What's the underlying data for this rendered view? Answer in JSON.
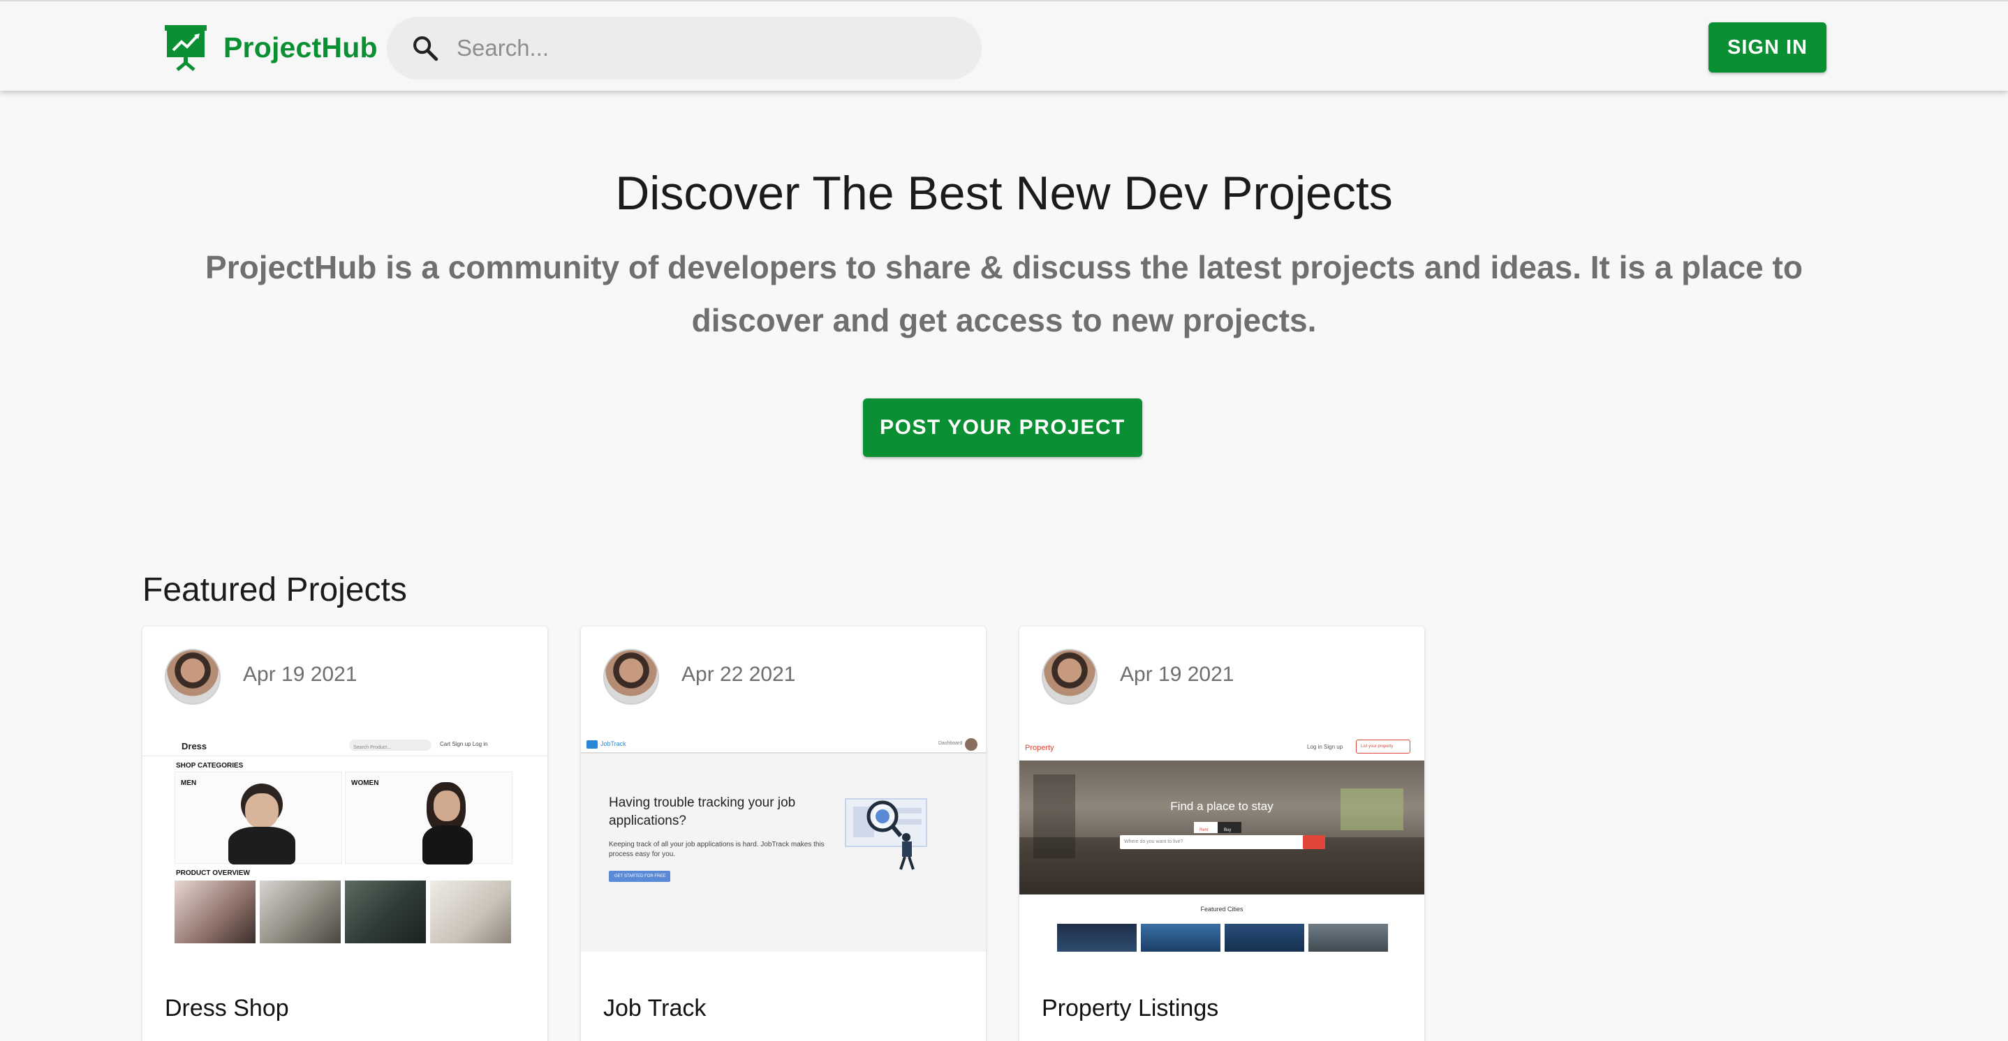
{
  "header": {
    "brand": "ProjectHub",
    "search_placeholder": "Search...",
    "signin_label": "SIGN IN"
  },
  "hero": {
    "title": "Discover The Best New Dev Projects",
    "subtitle": "ProjectHub is a community of developers to share & discuss the latest projects and ideas. It is a place to discover and get access to new projects.",
    "cta_label": "POST YOUR PROJECT"
  },
  "featured": {
    "title": "Featured Projects",
    "projects": [
      {
        "date": "Apr 19 2021",
        "title": "Dress Shop",
        "thumb": {
          "logo": "Dress",
          "search_placeholder": "Search Product...",
          "nav_links": "Cart  Sign up  Log in",
          "categories_label": "SHOP CATEGORIES",
          "men_label": "MEN",
          "women_label": "WOMEN",
          "overview_label": "PRODUCT OVERVIEW"
        }
      },
      {
        "date": "Apr 22 2021",
        "title": "Job Track",
        "thumb": {
          "logo": "JobTrack",
          "nav_right": "Dashboard",
          "headline": "Having trouble tracking your job applications?",
          "body": "Keeping track of all your job applications is hard. JobTrack makes this process easy for you.",
          "cta": "GET STARTED FOR FREE"
        }
      },
      {
        "date": "Apr 19 2021",
        "title": "Property Listings",
        "thumb": {
          "logo": "Property",
          "nav_links": "Log in    Sign up",
          "list_button": "List your property",
          "hero_title": "Find a place to stay",
          "tab_rent": "Rent",
          "tab_buy": "Buy",
          "search_placeholder": "Where do you want to live?",
          "featured_label": "Featured Cities"
        }
      }
    ]
  },
  "colors": {
    "brand_green": "#0a8f33",
    "background": "#f8f8f8",
    "subtitle_gray": "#6f6f6f"
  }
}
